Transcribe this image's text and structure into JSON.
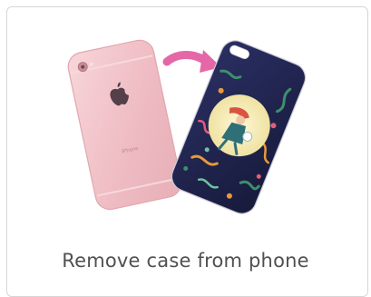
{
  "card": {
    "caption": "Remove case from phone"
  },
  "illustration": {
    "phone_color": "#f2c1c6",
    "arrow_color": "#e567a7",
    "case_background": "#1d2145",
    "moon_color": "#f5ecb9",
    "phone_back_text": "iPhone"
  }
}
